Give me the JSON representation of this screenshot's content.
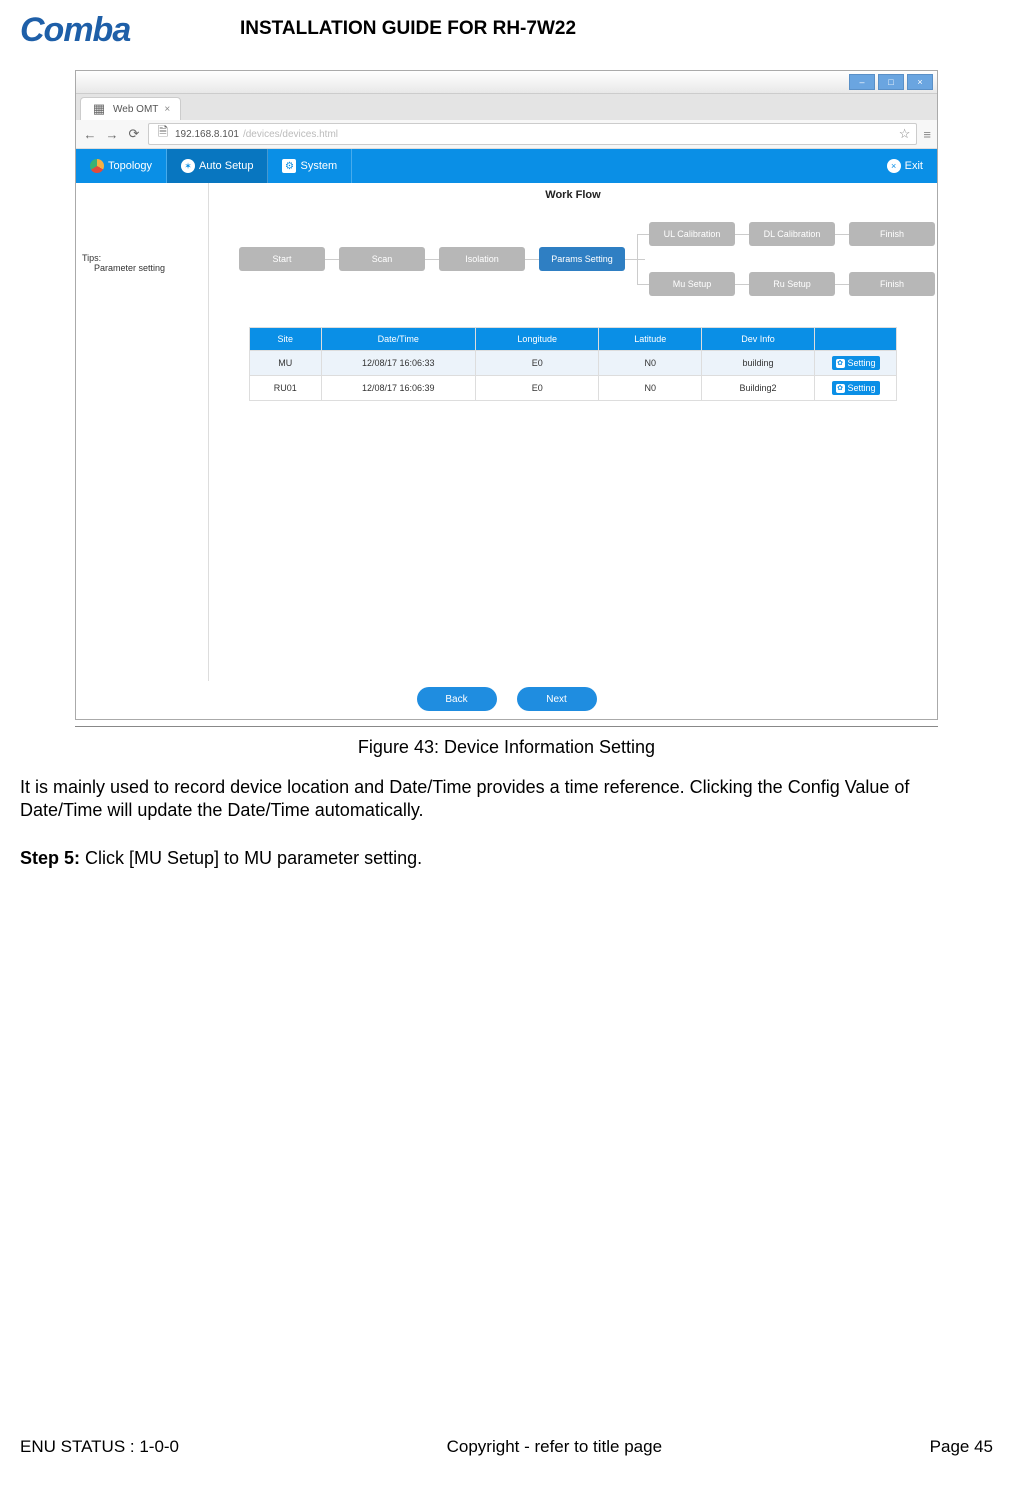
{
  "doc": {
    "title": "INSTALLATION GUIDE FOR RH-7W22",
    "logo": "Comba",
    "caption": "Figure 43: Device Information Setting",
    "para1": "It is mainly used to record device location and Date/Time provides a time reference. Clicking the Config Value of Date/Time will update the Date/Time automatically.",
    "step_label": "Step 5:",
    "step_text": " Click [MU Setup] to MU parameter setting.",
    "footer_left": "ENU STATUS : 1-0-0",
    "footer_mid": "Copyright - refer to title page",
    "footer_right": "Page 45"
  },
  "browser": {
    "tab_title": "Web OMT",
    "url_host": "192.168.8.101",
    "url_path": "/devices/devices.html"
  },
  "menubar": {
    "topology": "Topology",
    "auto_setup": "Auto Setup",
    "system": "System",
    "exit": "Exit"
  },
  "app": {
    "workflow_title": "Work Flow",
    "tips1": "Tips:",
    "tips2": "Parameter setting",
    "steps": {
      "start": "Start",
      "scan": "Scan",
      "isolation": "Isolation",
      "params": "Params Setting",
      "ul": "UL Calibration",
      "dl": "DL Calibration",
      "mu": "Mu Setup",
      "ru": "Ru Setup",
      "finish": "Finish"
    },
    "table": {
      "headers": {
        "site": "Site",
        "date": "Date/Time",
        "lon": "Longitude",
        "lat": "Latitude",
        "dev": "Dev Info"
      },
      "setting_label": "Setting",
      "rows": [
        {
          "site": "MU",
          "date": "12/08/17 16:06:33",
          "lon": "E0",
          "lat": "N0",
          "dev": "building"
        },
        {
          "site": "RU01",
          "date": "12/08/17 16:06:39",
          "lon": "E0",
          "lat": "N0",
          "dev": "Building2"
        }
      ]
    },
    "nav": {
      "back": "Back",
      "next": "Next"
    }
  }
}
